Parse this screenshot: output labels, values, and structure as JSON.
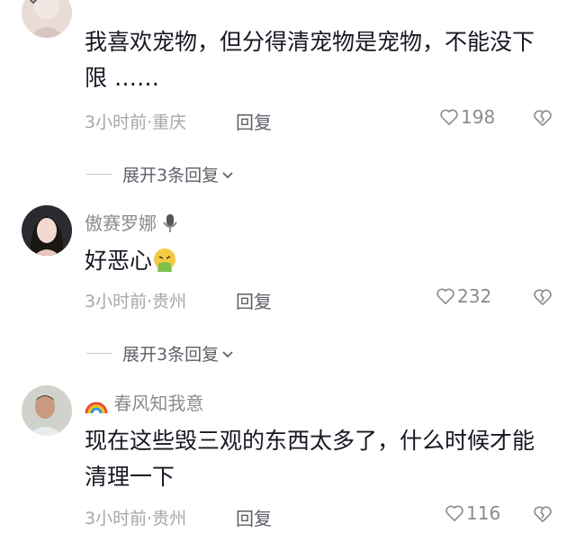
{
  "comments": [
    {
      "username": "",
      "text": "我喜欢宠物，但分得清宠物是宠物，不能没下限 ……",
      "meta": "3小时前·重庆",
      "reply_label": "回复",
      "likes": "198",
      "expand_label": "展开3条回复"
    },
    {
      "username": "傲赛罗娜",
      "text": "好恶心",
      "meta": "3小时前·贵州",
      "reply_label": "回复",
      "likes": "232",
      "expand_label": "展开3条回复"
    },
    {
      "username": "春风知我意",
      "text": "现在这些毁三观的东西太多了，什么时候才能清理一下",
      "meta": "3小时前·贵州",
      "reply_label": "回复",
      "likes": "116"
    }
  ],
  "icons": {
    "like": "heart-outline-icon",
    "dislike": "broken-heart-icon",
    "expand": "chevron-down-icon",
    "emoji": "nauseated-face-emoji",
    "badge": "microphone-icon",
    "name_prefix": "rainbow-icon"
  },
  "colors": {
    "text": "#161823",
    "meta": "#a6a7ab",
    "username": "#8a8b91",
    "reply": "#5e6068"
  }
}
